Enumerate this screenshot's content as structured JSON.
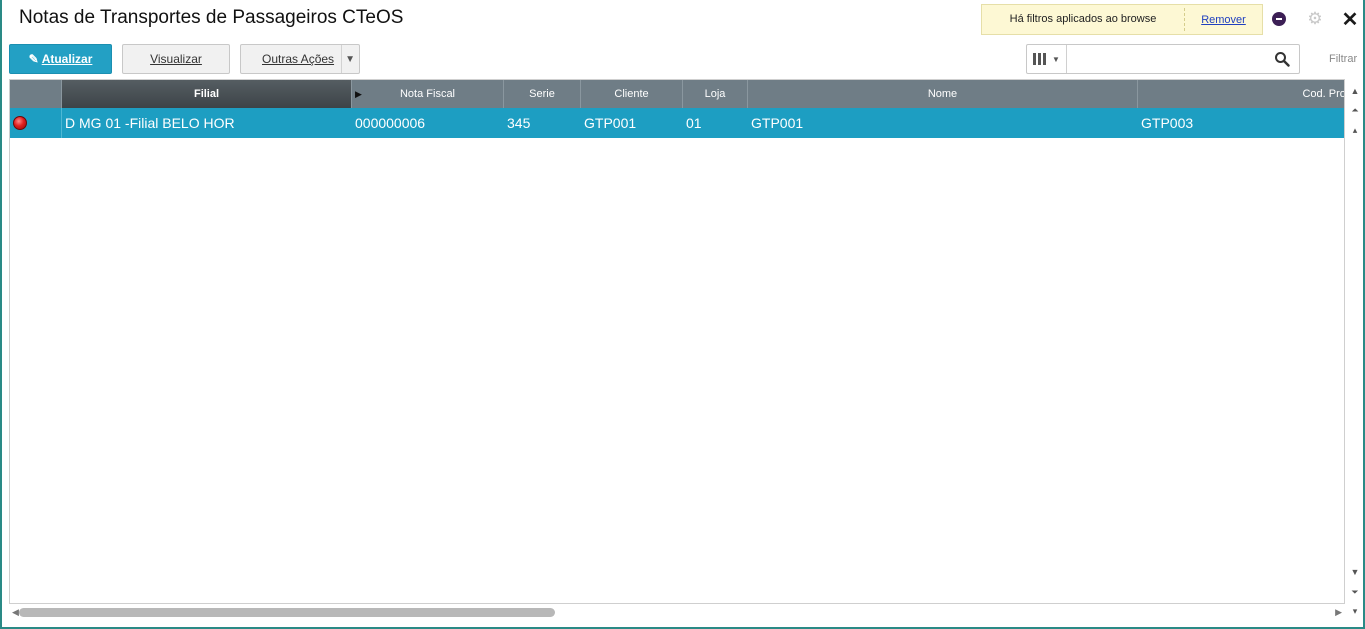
{
  "header": {
    "title": "Notas de Transportes de Passageiros CTeOS",
    "filter_notice": "Há filtros aplicados ao browse",
    "remove_link": "Remover"
  },
  "toolbar": {
    "atualizar_label": "Atualizar",
    "visualizar_label": "Visualizar",
    "outras_acoes_label": "Outras Ações"
  },
  "search": {
    "value": "",
    "placeholder": "",
    "filter_label": "Filtrar"
  },
  "grid": {
    "columns": [
      "Filial",
      "Nota Fiscal",
      "Serie",
      "Cliente",
      "Loja",
      "Nome",
      "Cod. Prod"
    ],
    "rows": [
      {
        "status": "red",
        "filial": "D MG 01 -Filial BELO HOR",
        "nota_fiscal": "000000006",
        "serie": "345",
        "cliente": "GTP001",
        "loja": "01",
        "nome": "GTP001",
        "cod_prod": "GTP003"
      }
    ]
  },
  "colors": {
    "accent": "#23a0c4",
    "header_bg": "#6f7d86",
    "selected_row": "#1d9ec2",
    "status_red": "#e02020",
    "notice_bg": "#fdf8d4"
  },
  "icons": [
    "pencil-icon",
    "menu-dot-icon",
    "gear-icon",
    "close-icon",
    "columns-icon",
    "search-icon",
    "status-red-icon"
  ]
}
